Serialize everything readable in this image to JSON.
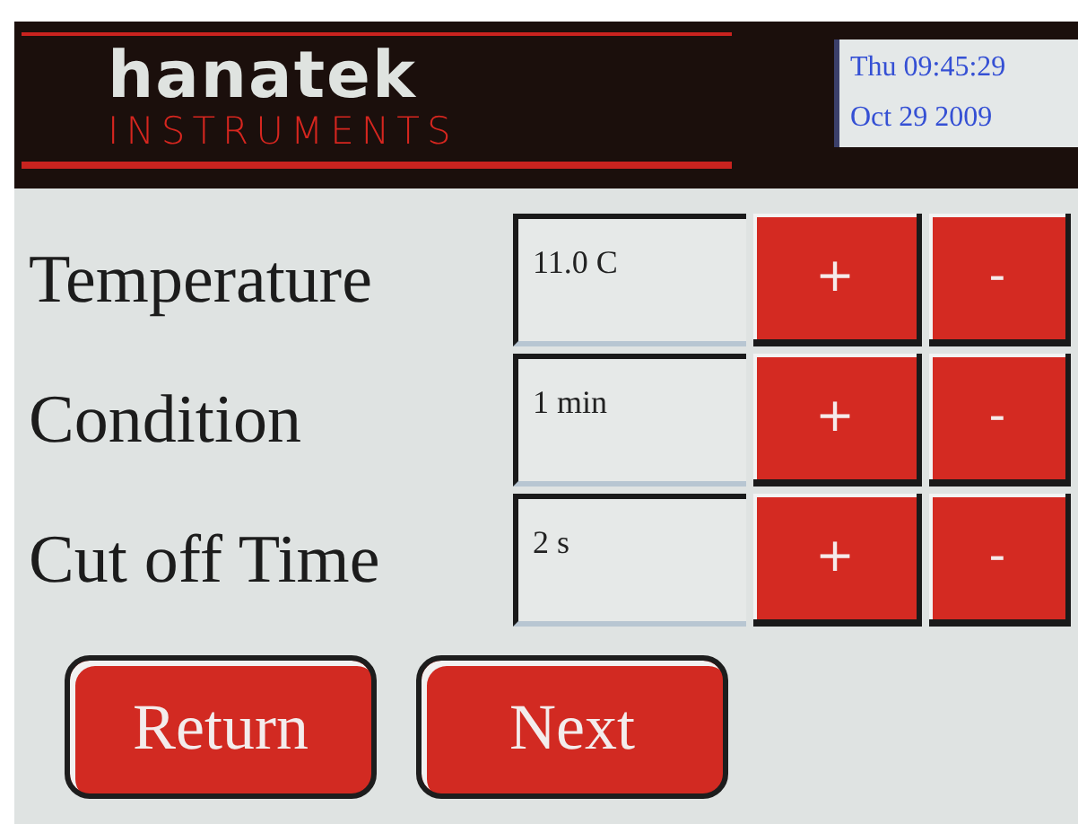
{
  "header": {
    "brand": "hanatek",
    "subtitle": "INSTRUMENTS",
    "clock": {
      "time": "Thu 09:45:29",
      "date": "Oct 29  2009"
    }
  },
  "settings": [
    {
      "label": "Temperature",
      "value": "11.0 C",
      "increase": "+",
      "decrease": "-"
    },
    {
      "label": "Condition",
      "value": "1 min",
      "increase": "+",
      "decrease": "-"
    },
    {
      "label": "Cut off Time",
      "value": "2 s",
      "increase": "+",
      "decrease": "-"
    }
  ],
  "buttons": [
    "Return",
    "Next"
  ]
}
